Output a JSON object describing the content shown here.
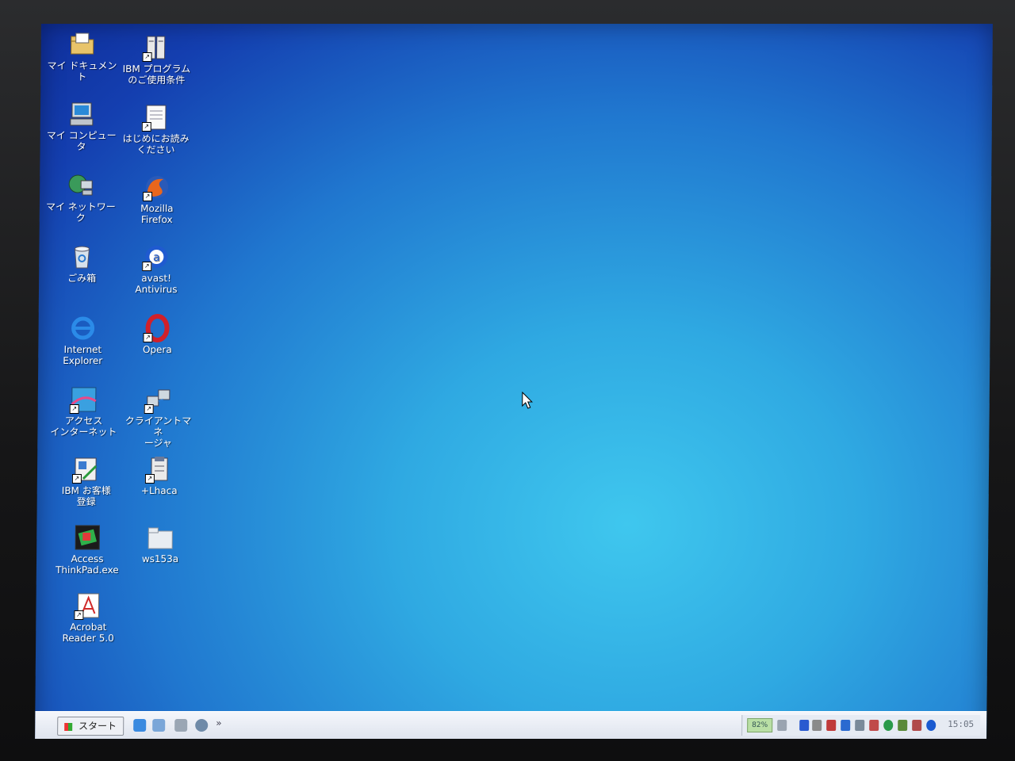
{
  "desktop": {
    "icons": [
      {
        "label": "マイ ドキュメント",
        "icon": "folder-documents-icon"
      },
      {
        "label": "IBM プログラム\nのご使用条件",
        "icon": "ibm-license-icon"
      },
      {
        "label": "マイ コンピュータ",
        "icon": "computer-icon"
      },
      {
        "label": "はじめにお読み\nください",
        "icon": "readme-icon"
      },
      {
        "label": "マイ ネットワーク",
        "icon": "network-icon"
      },
      {
        "label": "Mozilla\nFirefox",
        "icon": "firefox-icon"
      },
      {
        "label": "ごみ箱",
        "icon": "recycle-bin-icon"
      },
      {
        "label": "avast!\nAntivirus",
        "icon": "avast-icon"
      },
      {
        "label": "Internet\nExplorer",
        "icon": "internet-explorer-icon"
      },
      {
        "label": "Opera",
        "icon": "opera-icon"
      },
      {
        "label": "アクセス\nインターネット",
        "icon": "access-internet-icon"
      },
      {
        "label": "クライアントマネ\nージャ",
        "icon": "client-manager-icon"
      },
      {
        "label": "IBM お客様\n登録",
        "icon": "ibm-registration-icon"
      },
      {
        "label": "+Lhaca",
        "icon": "lhaca-icon"
      },
      {
        "label": "Access\nThinkPad.exe",
        "icon": "thinkpad-icon"
      },
      {
        "label": "ws153a",
        "icon": "folder-icon"
      },
      {
        "label": "Acrobat\nReader 5.0",
        "icon": "acrobat-reader-icon"
      }
    ]
  },
  "taskbar": {
    "start_label": "スタート",
    "quicklaunch": [
      "ie-icon",
      "desktop-icon",
      "outlook-icon",
      "media-icon"
    ],
    "chevron": "»",
    "battery": "82%",
    "clock": "15:05"
  },
  "colors": {
    "desktop_top": "#143fb0",
    "desktop_center": "#3fc7ee",
    "taskbar": "#e6ebf3"
  }
}
